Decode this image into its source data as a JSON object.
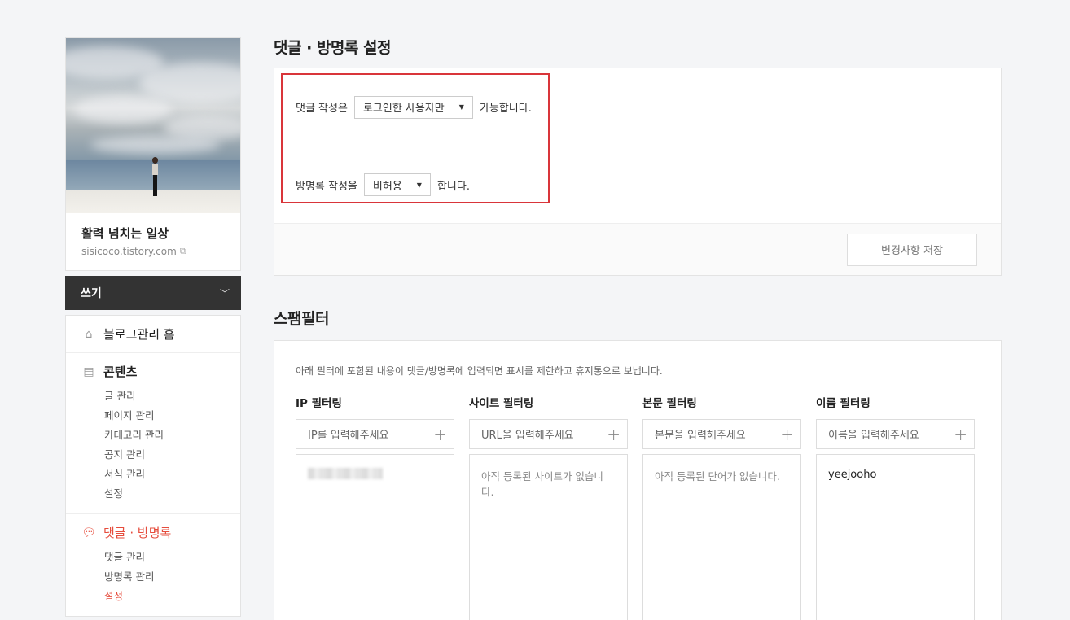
{
  "profile": {
    "blog_title": "활력 넘치는 일상",
    "blog_url": "sisicoco.tistory.com"
  },
  "write": {
    "label": "쓰기"
  },
  "menu": {
    "home": "블로그관리 홈",
    "content": {
      "title": "콘텐츠",
      "items": [
        "글 관리",
        "페이지 관리",
        "카테고리 관리",
        "공지 관리",
        "서식 관리",
        "설정"
      ]
    },
    "comments": {
      "title": "댓글 · 방명록",
      "items": [
        "댓글 관리",
        "방명록 관리",
        "설정"
      ]
    }
  },
  "settings": {
    "title": "댓글 · 방명록 설정",
    "comment_prefix": "댓글 작성은",
    "comment_select": "로그인한 사용자만",
    "comment_suffix": "가능합니다.",
    "guestbook_prefix": "방명록 작성을",
    "guestbook_select": "비허용",
    "guestbook_suffix": "합니다.",
    "save_button": "변경사항 저장"
  },
  "spam": {
    "title": "스팸필터",
    "description": "아래 필터에 포함된 내용이 댓글/방명록에 입력되면 표시를 제한하고 휴지통으로 보냅니다.",
    "filters": [
      {
        "label": "IP 필터링",
        "placeholder": "IP를 입력해주세요",
        "empty": ""
      },
      {
        "label": "사이트 필터링",
        "placeholder": "URL을 입력해주세요",
        "empty": "아직 등록된 사이트가 없습니다."
      },
      {
        "label": "본문 필터링",
        "placeholder": "본문을 입력해주세요",
        "empty": "아직 등록된 단어가 없습니다."
      },
      {
        "label": "이름 필터링",
        "placeholder": "이름을 입력해주세요",
        "value": "yeejooho"
      }
    ]
  },
  "colors": {
    "accent": "#e64c3c",
    "highlight_border": "#d9353a",
    "write_bar": "#333333"
  }
}
